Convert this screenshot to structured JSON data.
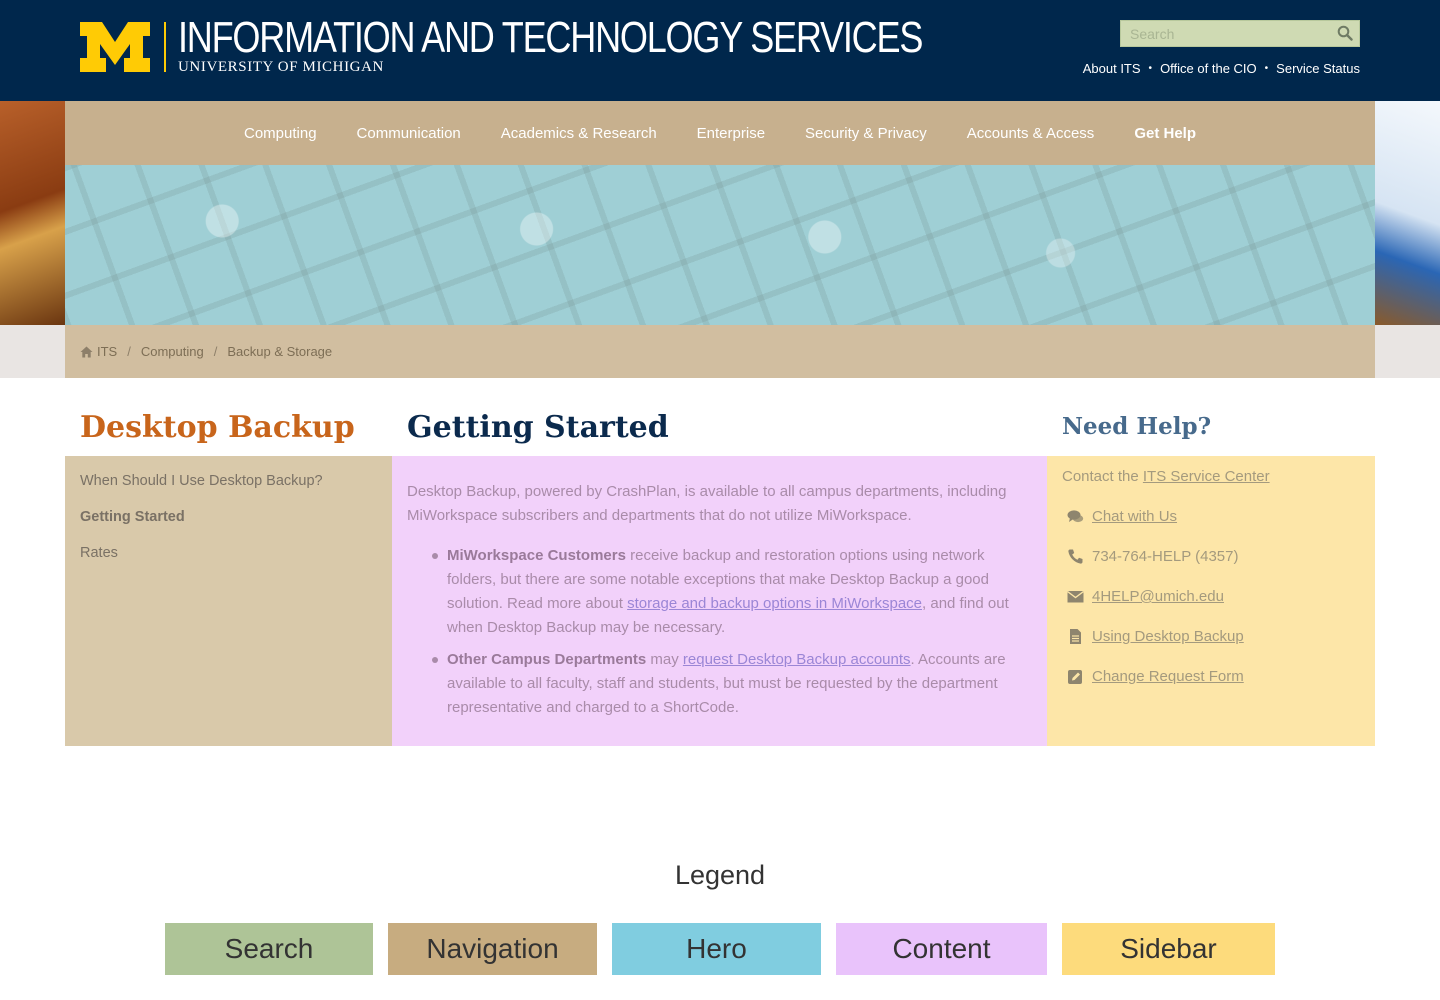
{
  "header": {
    "title": "INFORMATION AND TECHNOLOGY SERVICES",
    "subtitle": "UNIVERSITY OF MICHIGAN",
    "logo_icon": "block-m-logo",
    "search_placeholder": "Search",
    "utility_links": [
      "About ITS",
      "Office of the CIO",
      "Service Status"
    ]
  },
  "nav": {
    "items": [
      "Computing",
      "Communication",
      "Academics & Research",
      "Enterprise",
      "Security & Privacy",
      "Accounts & Access",
      "Get Help"
    ]
  },
  "breadcrumb": {
    "items": [
      "ITS",
      "Computing",
      "Backup & Storage"
    ],
    "separator": "/"
  },
  "left": {
    "heading": "Desktop Backup",
    "links": [
      "When Should I Use Desktop Backup?",
      "Getting Started",
      "Rates"
    ],
    "active_index": 1
  },
  "content": {
    "heading": "Getting Started",
    "intro": "Desktop Backup, powered by CrashPlan, is available to all campus departments, including MiWorkspace subscribers and departments that do not utilize MiWorkspace.",
    "bullets": [
      {
        "strong": "MiWorkspace Customers",
        "text_a": " receive backup and restoration options using network folders, but there are some notable exceptions that make Desktop Backup a good solution. Read more about ",
        "link": "storage and backup options in MiWorkspace",
        "text_b": ", and find out when Desktop Backup may be necessary."
      },
      {
        "strong": "Other Campus Departments",
        "text_a": " may ",
        "link": "request Desktop Backup accounts",
        "text_b": ". Accounts are available to all faculty, staff and students, but must be requested by the department representative and charged to a ShortCode."
      }
    ]
  },
  "sidebar": {
    "heading": "Need Help?",
    "contact_prefix": "Contact the ",
    "contact_link": "ITS Service Center",
    "items": [
      {
        "icon": "chat-icon",
        "label": "Chat with Us",
        "link": true
      },
      {
        "icon": "phone-icon",
        "label": "734-764-HELP (4357)",
        "link": false
      },
      {
        "icon": "envelope-icon",
        "label": "4HELP@umich.edu",
        "link": true
      },
      {
        "icon": "document-icon",
        "label": "Using Desktop Backup",
        "link": true
      },
      {
        "icon": "edit-icon",
        "label": "Change Request Form",
        "link": true
      }
    ]
  },
  "legend": {
    "title": "Legend",
    "items": [
      {
        "label": "Search",
        "color": "#aec497"
      },
      {
        "label": "Navigation",
        "color": "#c7ac80"
      },
      {
        "label": "Hero",
        "color": "#80cde0"
      },
      {
        "label": "Content",
        "color": "#e9c3fb"
      },
      {
        "label": "Sidebar",
        "color": "#fddb7c"
      }
    ]
  },
  "colors": {
    "header_bg": "#00274c",
    "maize": "#ffcb05",
    "heading_orange": "#c8651b",
    "heading_navy": "#0b2a4d",
    "sidebar_heading": "#476a8c"
  }
}
